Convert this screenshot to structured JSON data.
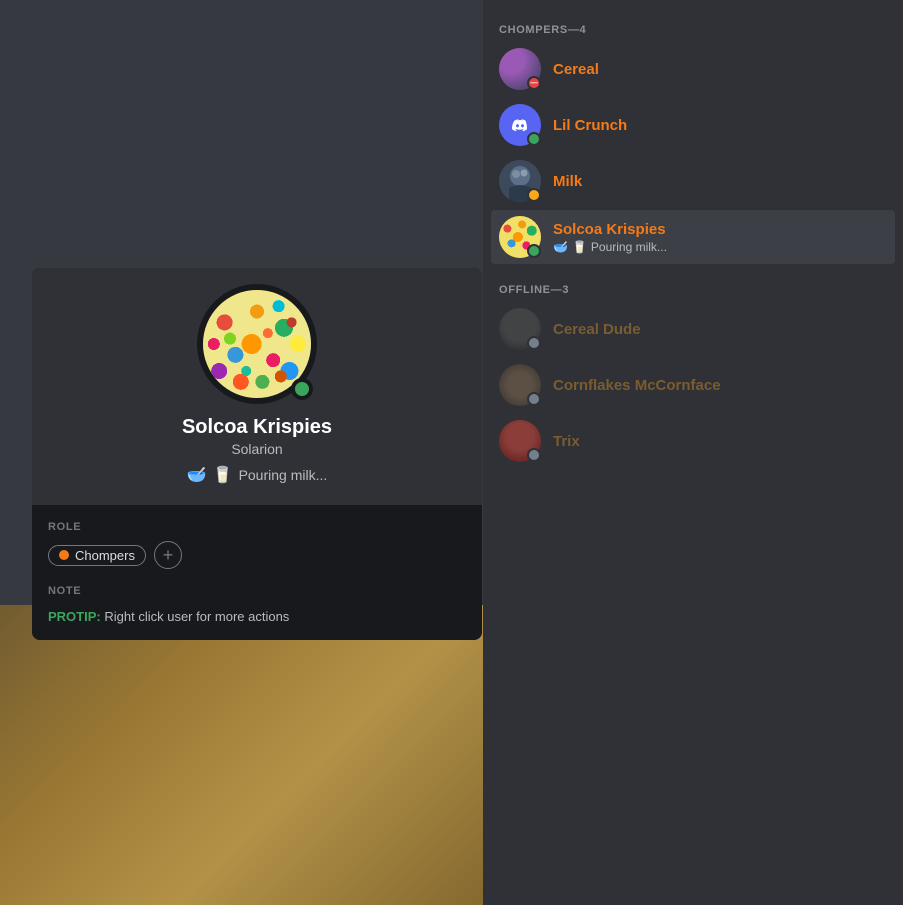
{
  "left_bg": {
    "visible": true
  },
  "profile_card": {
    "username": "Solcoa Krispies",
    "subtitle": "Solarion",
    "status_emoji1": "🥣",
    "status_emoji2": "🥛",
    "status_text": "Pouring milk...",
    "online": true,
    "role_section_label": "ROLE",
    "role_name": "Chompers",
    "add_role_label": "+",
    "note_section_label": "NOTE",
    "protip_label": "PROTIP:",
    "protip_text": "Right click user for more actions"
  },
  "member_list": {
    "category_online": "CHOMPERS—4",
    "category_offline": "OFFLINE—3",
    "online_members": [
      {
        "name": "Cereal",
        "status": "dnd",
        "activity": null
      },
      {
        "name": "Lil Crunch",
        "status": "online",
        "activity": null
      },
      {
        "name": "Milk",
        "status": "idle",
        "activity": null
      },
      {
        "name": "Solcoa Krispies",
        "status": "online",
        "activity_emoji1": "🥣",
        "activity_emoji2": "🥛",
        "activity_text": "Pouring milk...",
        "selected": true
      }
    ],
    "offline_members": [
      {
        "name": "Cereal Dude",
        "status": "offline"
      },
      {
        "name": "Cornflakes McCornface",
        "status": "offline"
      },
      {
        "name": "Trix",
        "status": "offline"
      }
    ]
  }
}
